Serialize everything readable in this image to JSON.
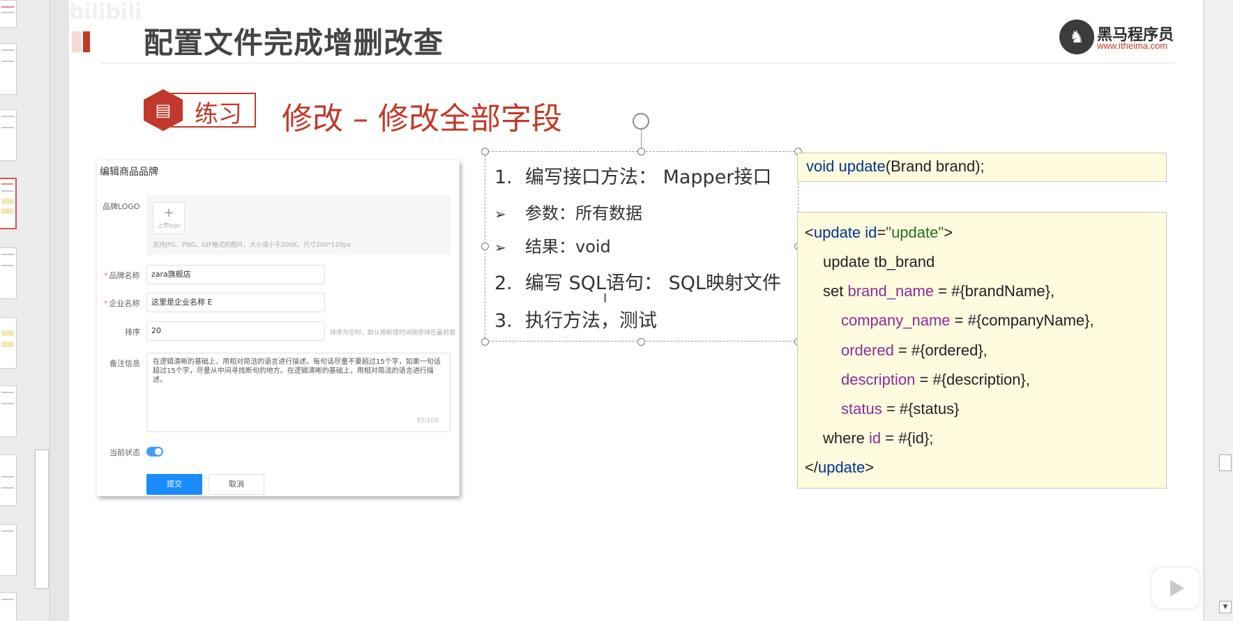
{
  "watermark": "bilibili",
  "slide": {
    "title": "配置文件完成增删改查",
    "logo": {
      "name": "黑马程序员",
      "url": "www.itheima.com"
    },
    "badge_label": "练习",
    "section_title": "修改 – 修改全部字段"
  },
  "form": {
    "title": "编辑商品品牌",
    "logo_label": "品牌LOGO",
    "upload_text": "上传logo",
    "upload_hint": "支持JPG、PNG、GIF格式的图片，大小请小于200K，尺寸200*120px",
    "brand_name_label": "品牌名称",
    "brand_name_value": "zara旗舰店",
    "company_label": "企业名称",
    "company_value": "这里是企业名称 E",
    "order_label": "排序",
    "order_value": "20",
    "order_hint": "排序为空时，默认按新增时间倒序排在最前面",
    "desc_label": "备注信息",
    "desc_value": "在逻辑清晰的基础上，用相对简洁的语言进行描述。每句话尽量不要超过15个字，如果一句话超过15个字，尽量从中间寻找断句的地方。在逻辑清晰的基础上，用相对简洁的语言进行描述。",
    "desc_count": "85/200",
    "status_label": "当前状态",
    "status_on": true,
    "submit_label": "提交",
    "cancel_label": "取消"
  },
  "steps": {
    "step1_num": "1.",
    "step1_text": "编写接口方法： Mapper接口",
    "bullet1": "参数：所有数据",
    "bullet2": "结果：void",
    "step2_num": "2.",
    "step2_text": "编写 SQL语句： SQL映射文件",
    "step3_num": "3.",
    "step3_text": "执行方法，测试",
    "bullet_symbol": "➢"
  },
  "code": {
    "signature": {
      "void": "void",
      "method": "update",
      "params": "(Brand brand);"
    },
    "xml": {
      "open_lt": "<",
      "open_tag": "update",
      "attr": " id",
      "eq": "=",
      "attr_val": "\"update\"",
      "open_gt": ">",
      "line_update": "update tb_brand",
      "set_kw": "set ",
      "f1": "brand_name",
      "v1": " = #{brandName},",
      "f2": "company_name",
      "v2": " = #{companyName},",
      "f3": "ordered",
      "v3": " = #{ordered},",
      "f4": "description",
      "v4": " = #{description},",
      "f5": "status",
      "v5": " = #{status}",
      "where_kw": "where ",
      "f6": "id",
      "v6": " = #{id};",
      "close_lt": "</",
      "close_tag": "update",
      "close_gt": ">"
    }
  },
  "colors": {
    "accent": "#c0392b",
    "code_bg": "#fefbdf",
    "keyword": "#00338f",
    "field": "#8b2e96",
    "string": "#1f6f1f",
    "button": "#1a8cff"
  }
}
